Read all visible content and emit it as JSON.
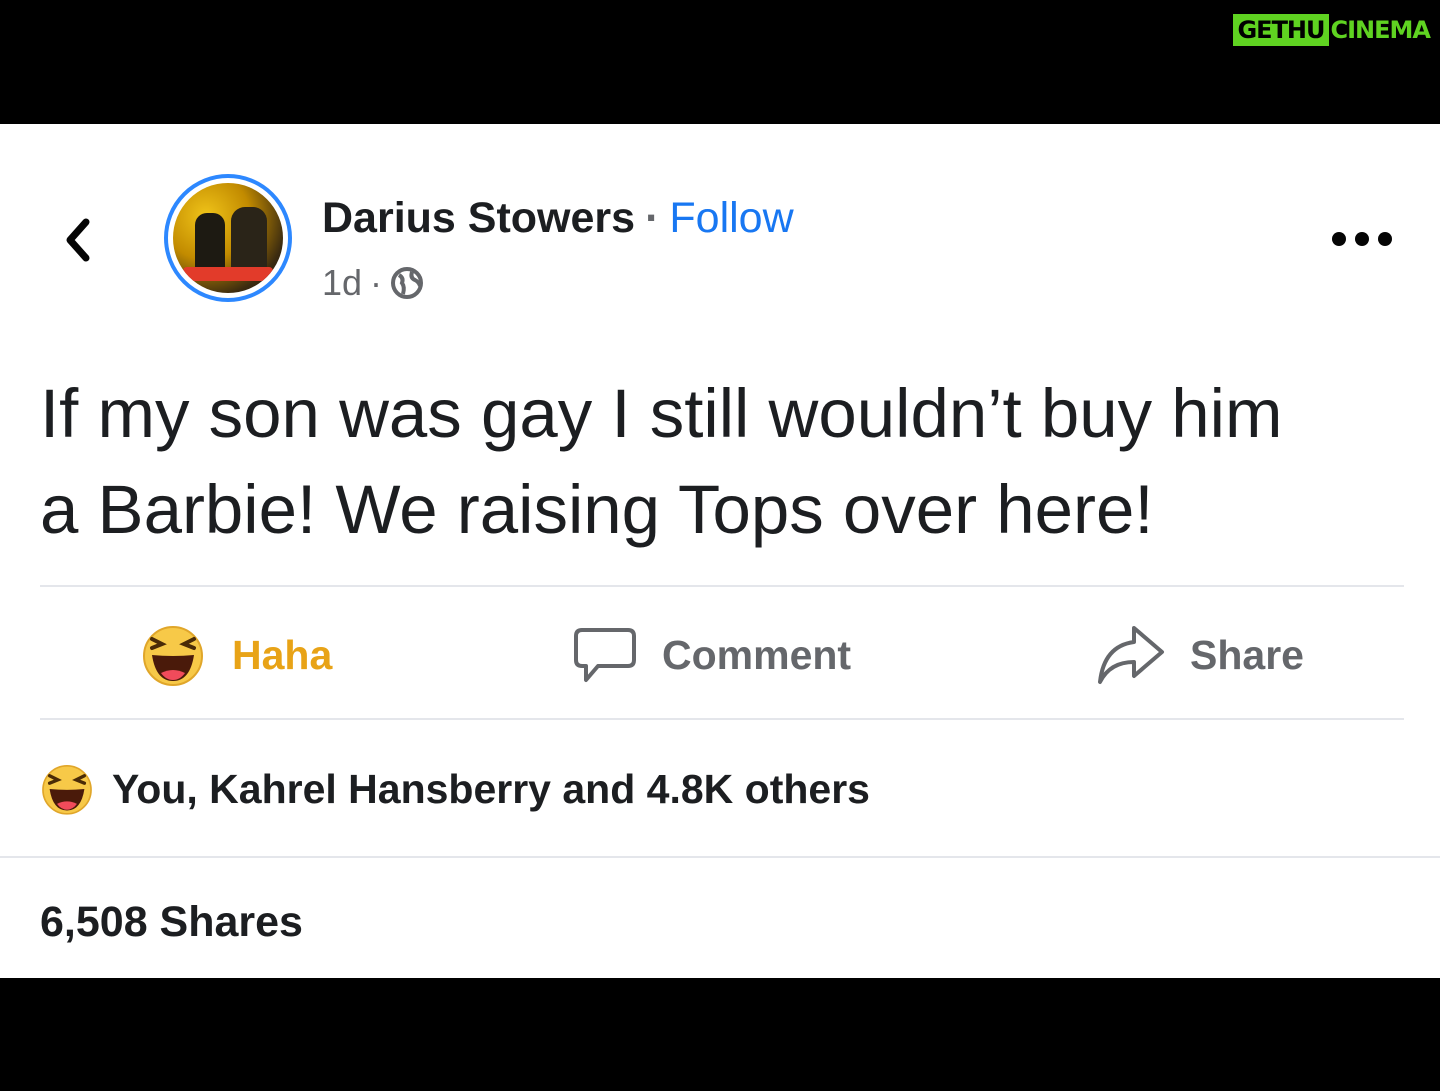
{
  "watermark": {
    "part1": "GETHU",
    "part2": "CINEMA"
  },
  "post": {
    "author": "Darius Stowers",
    "separator": "·",
    "follow_label": "Follow",
    "timestamp": "1d",
    "meta_separator": "·",
    "privacy_icon": "globe-icon",
    "text": "If my son was gay I still wouldn’t buy him\na Barbie! We raising Tops over here!"
  },
  "actions": {
    "haha_label": "Haha",
    "comment_label": "Comment",
    "share_label": "Share"
  },
  "reactions": {
    "summary": "You, Kahrel Hansberry and 4.8K others"
  },
  "shares": {
    "count_label": "6,508 Shares"
  },
  "colors": {
    "follow": "#1877f2",
    "haha": "#e8a317",
    "avatar_ring": "#2d88ff",
    "watermark_green": "#5fd321"
  }
}
